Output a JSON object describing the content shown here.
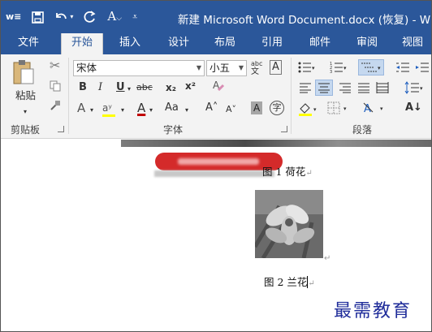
{
  "titlebar": {
    "title": "新建 Microsoft Word Document.docx (恢复) - W",
    "word_glyph": "w≡",
    "font_color_glyph": "A"
  },
  "tabs": [
    {
      "label": "文件",
      "active": false
    },
    {
      "label": "开始",
      "active": true
    },
    {
      "label": "插入",
      "active": false
    },
    {
      "label": "设计",
      "active": false
    },
    {
      "label": "布局",
      "active": false
    },
    {
      "label": "引用",
      "active": false
    },
    {
      "label": "邮件",
      "active": false
    },
    {
      "label": "审阅",
      "active": false
    },
    {
      "label": "视图",
      "active": false
    }
  ],
  "ribbon": {
    "clipboard": {
      "paste_label": "粘贴",
      "group_label": "剪贴板"
    },
    "font": {
      "font_name": "宋体",
      "font_size": "小五",
      "bold": "B",
      "italic": "I",
      "underline": "U",
      "strikethrough": "abc",
      "subscript": "x₂",
      "superscript": "x²",
      "text_effects": "A",
      "highlight": "aʸ",
      "font_color": "A",
      "change_case": "Aa",
      "grow_font": "A˄",
      "shrink_font": "A˅",
      "char_shading": "A",
      "enclose_char": "字",
      "phonetic": "abc",
      "char_border": "A",
      "group_label": "字体"
    },
    "paragraph": {
      "group_label": "段落",
      "sort": "A↓"
    }
  },
  "document": {
    "caption1": "图 1 荷花",
    "caption2": "图 2 兰花",
    "watermark": "最需教育",
    "return_mark": "↵"
  },
  "colors": {
    "titlebar_bg": "#2b579a",
    "ribbon_bg": "#f3f3f3",
    "banner_red": "#d42a2a",
    "watermark_blue": "#1f2c9a"
  }
}
